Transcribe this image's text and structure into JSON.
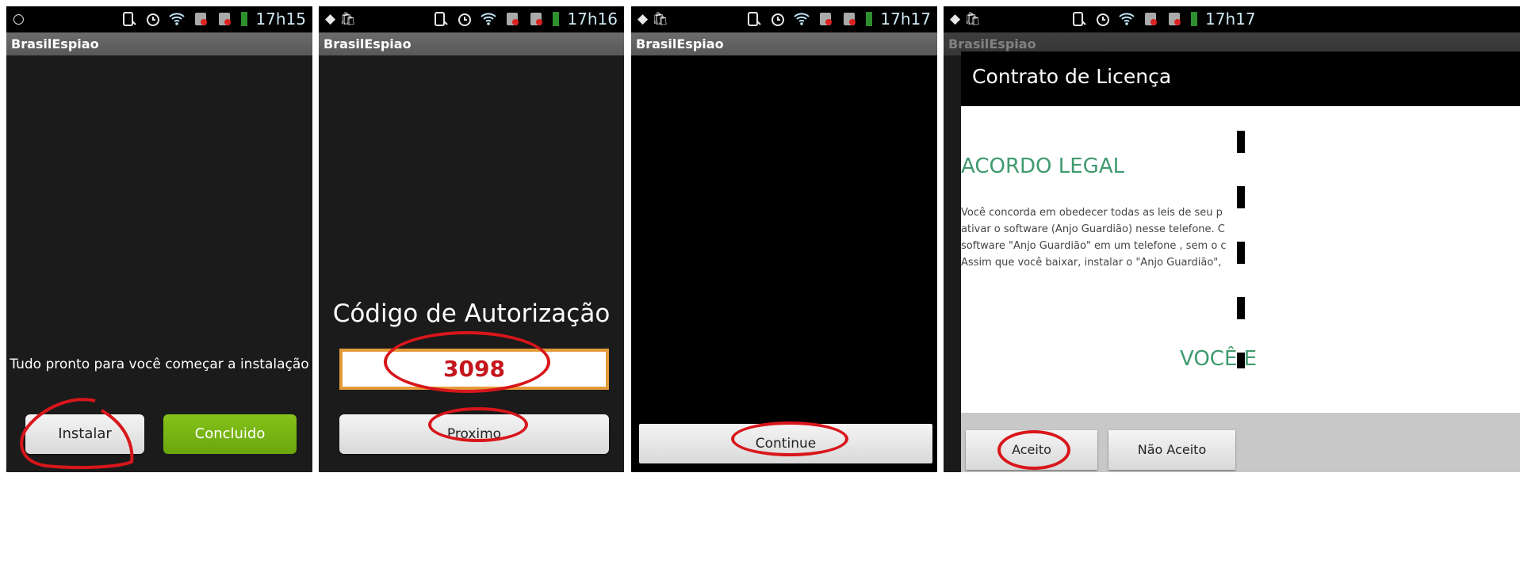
{
  "panels": [
    {
      "status": {
        "left_icon": "circle-icon",
        "time": "17h15"
      },
      "title": "BrasilEspiao",
      "message": "Tudo pronto para você começar a instalação",
      "buttons": {
        "install": "Instalar",
        "done": "Concluido"
      }
    },
    {
      "status": {
        "left_icon": "location-and-bag-icons",
        "time": "17h16"
      },
      "title": "BrasilEspiao",
      "heading": "Código de Autorização",
      "code": "3098",
      "buttons": {
        "next": "Proximo"
      }
    },
    {
      "status": {
        "left_icon": "location-and-bag-icons",
        "time": "17h17"
      },
      "title": "BrasilEspiao",
      "buttons": {
        "continue": "Continue"
      }
    },
    {
      "status": {
        "left_icon": "location-and-bag-icons",
        "time": "17h17"
      },
      "title": "BrasilEspiao",
      "dialog": {
        "title": "Contrato de Licença",
        "heading": "ACORDO LEGAL",
        "body_lines": [
          "Você concorda em obedecer todas as leis de seu p",
          "ativar o software (Anjo Guardião) nesse telefone. C",
          "software \"Anjo Guardião\" em um telefone , sem o c",
          "Assim que você baixar, instalar o \"Anjo Guardião\","
        ],
        "footer_text": "VOCÊ E",
        "accept": "Aceito",
        "reject": "Não Aceito"
      }
    }
  ],
  "colors": {
    "annotation": "#d8161b",
    "accent_green": "#3f9a6e",
    "code_red": "#c4161c"
  }
}
